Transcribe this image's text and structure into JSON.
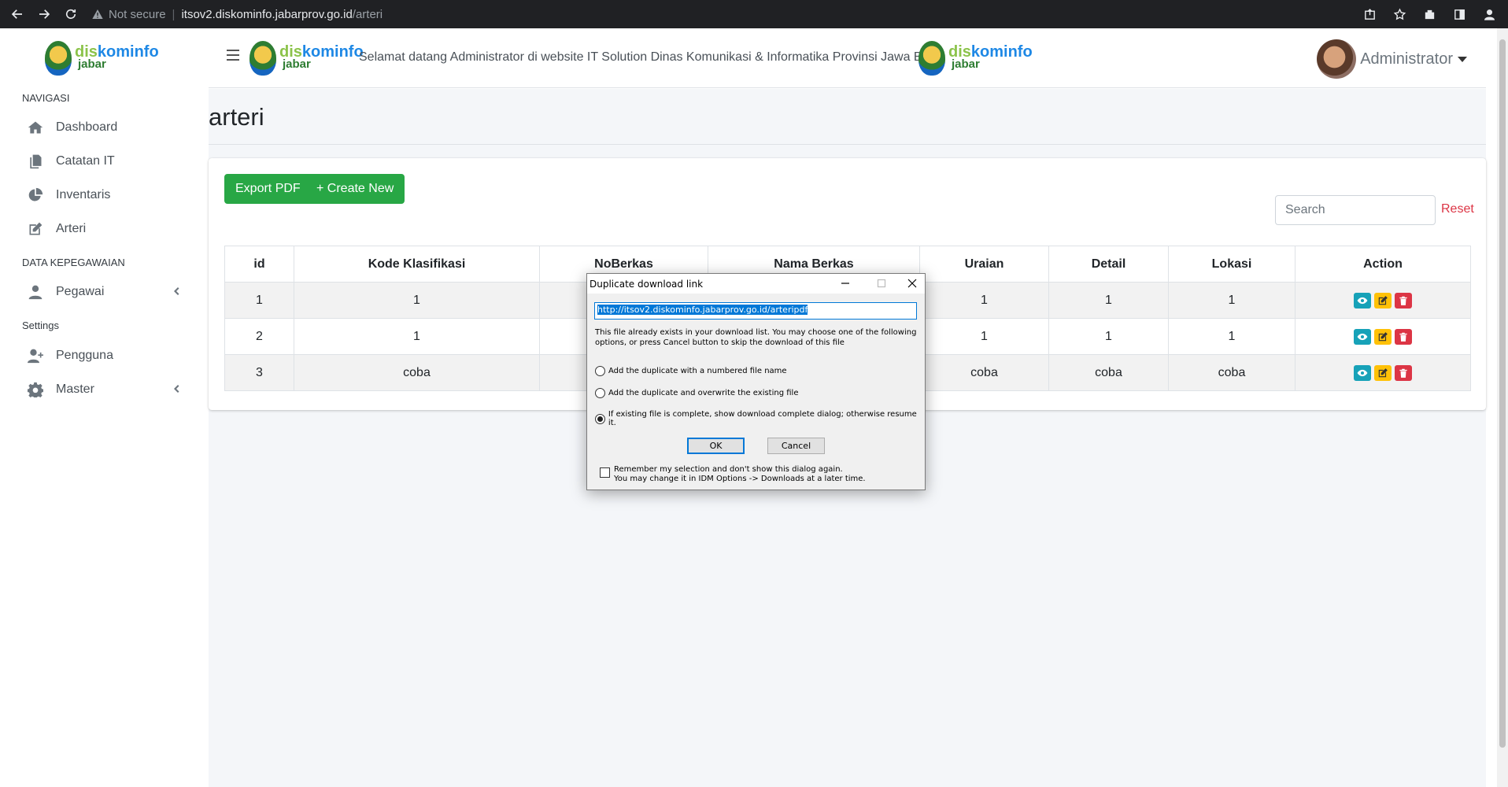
{
  "browser": {
    "security": "Not secure",
    "url_host": "itsov2.diskominfo.jabarprov.go.id",
    "url_path": "/arteri"
  },
  "brand": {
    "part1": "dis",
    "part2": "kominfo",
    "sub": "jabar"
  },
  "sidebar": {
    "sections": [
      {
        "title": "NAVIGASI"
      },
      {
        "title": "DATA KEPEGAWAIAN"
      },
      {
        "title": "Settings"
      }
    ],
    "items": [
      {
        "label": "Dashboard",
        "icon": "home-icon"
      },
      {
        "label": "Catatan IT",
        "icon": "copy-icon"
      },
      {
        "label": "Inventaris",
        "icon": "chart-pie-icon"
      },
      {
        "label": "Arteri",
        "icon": "edit-icon"
      },
      {
        "label": "Pegawai",
        "icon": "user-icon"
      },
      {
        "label": "Pengguna",
        "icon": "user-plus-icon"
      },
      {
        "label": "Master",
        "icon": "gear-icon"
      }
    ]
  },
  "header": {
    "welcome": "Selamat datang Administrator di website IT Solution Dinas Komunikasi & Informatika Provinsi Jawa Barat",
    "user_name": "Administrator"
  },
  "page": {
    "title": "arteri",
    "export_label": "Export PDF",
    "create_label": "+ Create New",
    "search_placeholder": "Search",
    "reset_label": "Reset"
  },
  "table": {
    "columns": [
      "id",
      "Kode Klasifikasi",
      "NoBerkas",
      "Nama Berkas",
      "Uraian",
      "Detail",
      "Lokasi",
      "Action"
    ],
    "rows": [
      {
        "id": "1",
        "kode": "1",
        "noberkas": "",
        "nama": "",
        "uraian": "1",
        "detail": "1",
        "lokasi": "1"
      },
      {
        "id": "2",
        "kode": "1",
        "noberkas": "",
        "nama": "",
        "uraian": "1",
        "detail": "1",
        "lokasi": "1"
      },
      {
        "id": "3",
        "kode": "coba",
        "noberkas": "",
        "nama": "",
        "uraian": "coba",
        "detail": "coba",
        "lokasi": "coba"
      }
    ]
  },
  "dialog": {
    "title": "Duplicate download link",
    "url": "http://itsov2.diskominfo.jabarprov.go.id/arteripdf",
    "message": "This file already exists in your download list. You may choose one of the following options, or press Cancel button to skip the download of this file",
    "options": [
      {
        "label": "Add the duplicate with a numbered file name",
        "selected": false
      },
      {
        "label": "Add the duplicate and overwrite the existing file",
        "selected": false
      },
      {
        "label": "If existing file is complete, show download complete dialog; otherwise resume it.",
        "selected": true
      }
    ],
    "ok_label": "OK",
    "cancel_label": "Cancel",
    "remember_line1": "Remember my selection and don't show this dialog again.",
    "remember_line2": "You may change it in IDM Options -> Downloads at a later time."
  },
  "colors": {
    "accent_green": "#28a745",
    "danger": "#dc3545",
    "info": "#17a2b8",
    "warning": "#ffc107"
  }
}
